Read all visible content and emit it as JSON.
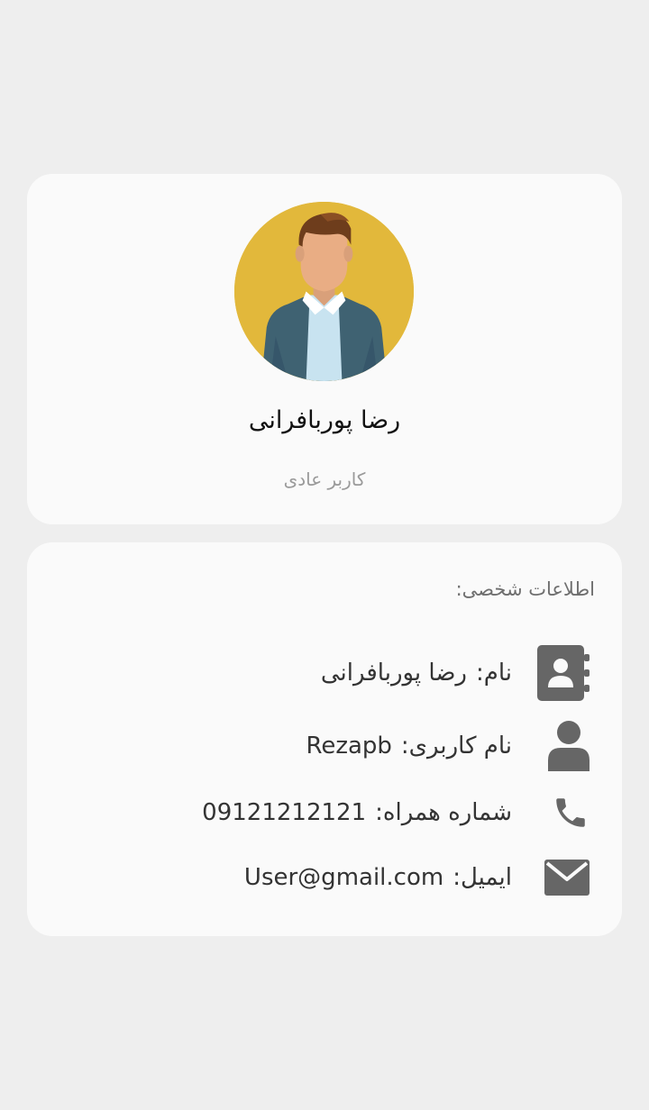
{
  "profile": {
    "name": "رضا پوربافرانی",
    "role": "کاربر عادی",
    "avatar_icon": "user-avatar-illustration"
  },
  "personal_info": {
    "title": "اطلاعات شخصی:",
    "rows": [
      {
        "icon": "contact-book-icon",
        "label": "نام:",
        "value": "رضا پوربافرانی"
      },
      {
        "icon": "user-icon",
        "label": "نام کاربری:",
        "value": "Rezapb"
      },
      {
        "icon": "phone-icon",
        "label": "شماره همراه:",
        "value": "09121212121"
      },
      {
        "icon": "envelope-icon",
        "label": "ایمیل:",
        "value": "User@gmail.com"
      }
    ]
  },
  "colors": {
    "background": "#eeeeee",
    "card": "#fafafa",
    "icon": "#666666",
    "avatar_bg": "#e2b83b"
  }
}
